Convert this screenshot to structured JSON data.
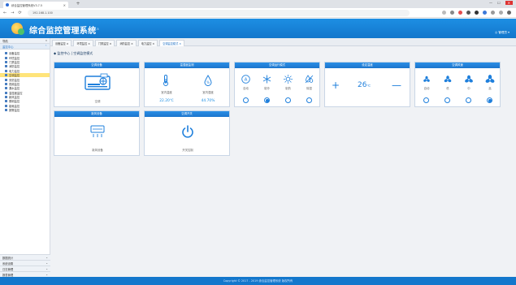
{
  "browser": {
    "tab_title": "综合监控管理系统V3.7.5",
    "url": "192.168.1.100",
    "nav": {
      "back": "←",
      "forward": "→",
      "reload": "⟳"
    },
    "window": {
      "min": "—",
      "max": "☐",
      "close": "✕"
    }
  },
  "app": {
    "title": "综合监控管理系统",
    "version": "V3.7.5",
    "user": "◎ 管理员 ▾",
    "footer": "Copyright © 2017 - 2019 综合监控管理系统 版权所有"
  },
  "sidebar": {
    "header": "导航",
    "section": "监控中心",
    "items": [
      {
        "label": "设备监控"
      },
      {
        "label": "环境监控"
      },
      {
        "label": "门禁监控"
      },
      {
        "label": "消防监控"
      },
      {
        "label": "电力监控"
      },
      {
        "label": "空调监控"
      },
      {
        "label": "安防监控"
      },
      {
        "label": "视频监控"
      },
      {
        "label": "漏水监控"
      },
      {
        "label": "温湿度监控"
      },
      {
        "label": "新风监控"
      },
      {
        "label": "照明监控"
      },
      {
        "label": "能耗监控"
      },
      {
        "label": "报警监控"
      }
    ],
    "bottom": [
      {
        "label": "数据统计"
      },
      {
        "label": "系统设置"
      },
      {
        "label": "日志管理"
      },
      {
        "label": "报表管理"
      }
    ]
  },
  "content_tabs": [
    {
      "label": "设备监控 ×"
    },
    {
      "label": "环境监控 ×"
    },
    {
      "label": "门禁监控 ×"
    },
    {
      "label": "消防监控 ×"
    },
    {
      "label": "电力监控 ×"
    },
    {
      "label": "空调监控模式 ×"
    }
  ],
  "breadcrumb": "◆ 监控中心 | 空调监控模式",
  "panels": {
    "ac_device": {
      "title": "空调设备",
      "label": "空调"
    },
    "temp_humidity": {
      "title": "温湿度监测",
      "temp_label": "室内温度",
      "temp_value": "22.20℃",
      "hum_label": "室内湿度",
      "hum_value": "44.70%"
    },
    "mode": {
      "title": "空调运行模式",
      "options": [
        "自动",
        "制冷",
        "制热",
        "除湿"
      ],
      "selected": 1
    },
    "temperature": {
      "title": "设定温度",
      "value": "26",
      "unit": "℃",
      "plus": "+",
      "minus": "—"
    },
    "fan": {
      "title": "空调风速",
      "options": [
        "自动",
        "低",
        "中",
        "高"
      ],
      "selected": 3
    },
    "humidifier": {
      "title": "新风设备",
      "label": "新风设备"
    },
    "power": {
      "title": "空调开关",
      "label": "开关控制"
    }
  }
}
